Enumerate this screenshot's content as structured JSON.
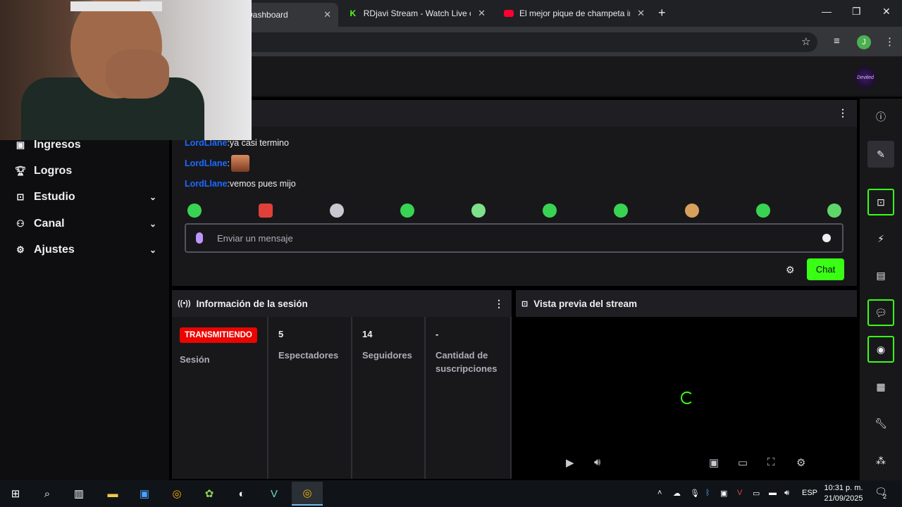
{
  "browser": {
    "tabs": [
      {
        "title": "Dashboard",
        "icon": "dashboard-favicon"
      },
      {
        "title": "RDjavi Stream - Watch Live on Kick",
        "icon": "kick-favicon"
      },
      {
        "title": "El mejor pique de champeta im",
        "icon": "youtube-favicon"
      }
    ],
    "profile_initial": "J"
  },
  "site": {
    "logo_text": "Devited"
  },
  "nav": {
    "items": [
      {
        "label": "Ingresos",
        "icon": "income-icon"
      },
      {
        "label": "Logros",
        "icon": "trophy-icon"
      },
      {
        "label": "Estudio",
        "icon": "studio-icon"
      },
      {
        "label": "Canal",
        "icon": "channel-icon"
      },
      {
        "label": "Ajustes",
        "icon": "settings-icon"
      }
    ]
  },
  "chat": {
    "messages": [
      {
        "user": "LordLlane",
        "sep": ":",
        "text": " ya casi termino"
      },
      {
        "user": "LordLlane",
        "sep": ":",
        "text": ""
      },
      {
        "user": "LordLlane",
        "sep": ":",
        "text": " vemos pues mijo"
      }
    ],
    "input_placeholder": "Enviar un mensaje",
    "send_label": "Chat"
  },
  "session": {
    "title": "Información de la sesión",
    "status": "TRANSMITIENDO",
    "session_label": "Sesión",
    "stats": [
      {
        "value": "5",
        "label": "Espectadores"
      },
      {
        "value": "14",
        "label": "Seguidores"
      },
      {
        "value": "-",
        "label": "Cantidad de suscripciones"
      }
    ]
  },
  "preview": {
    "title": "Vista previa del stream"
  },
  "taskbar": {
    "lang": "ESP",
    "time": "10:31 p. m.",
    "date": "21/09/2025",
    "notifications": "2"
  },
  "colors": {
    "accent": "#39ff14",
    "live": "#eb0400",
    "username": "#1e69ff"
  }
}
